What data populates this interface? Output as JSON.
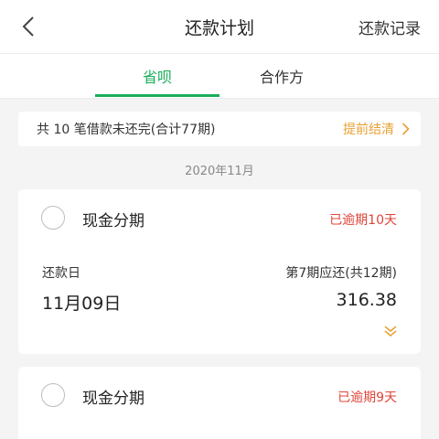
{
  "header": {
    "title": "还款计划",
    "record_label": "还款记录"
  },
  "tabs": [
    {
      "label": "省呗",
      "active": true
    },
    {
      "label": "合作方",
      "active": false
    }
  ],
  "summary": {
    "text": "共 10 笔借款未还完(合计77期)",
    "prepay_label": "提前结清"
  },
  "month_label": "2020年11月",
  "cards": [
    {
      "name": "现金分期",
      "status": "已逾期10天",
      "date_label": "还款日",
      "period_label": "第7期应还(共12期)",
      "date_value": "11月09日",
      "amount": "316.38"
    },
    {
      "name": "现金分期",
      "status": "已逾期9天"
    }
  ],
  "colors": {
    "accent": "#1aad5a",
    "warning": "#e8a033",
    "overdue": "#e0453a"
  },
  "icons": {
    "back": "chevron-left-icon",
    "prepay": "chevron-right-icon",
    "expand": "double-chevron-down-icon"
  }
}
